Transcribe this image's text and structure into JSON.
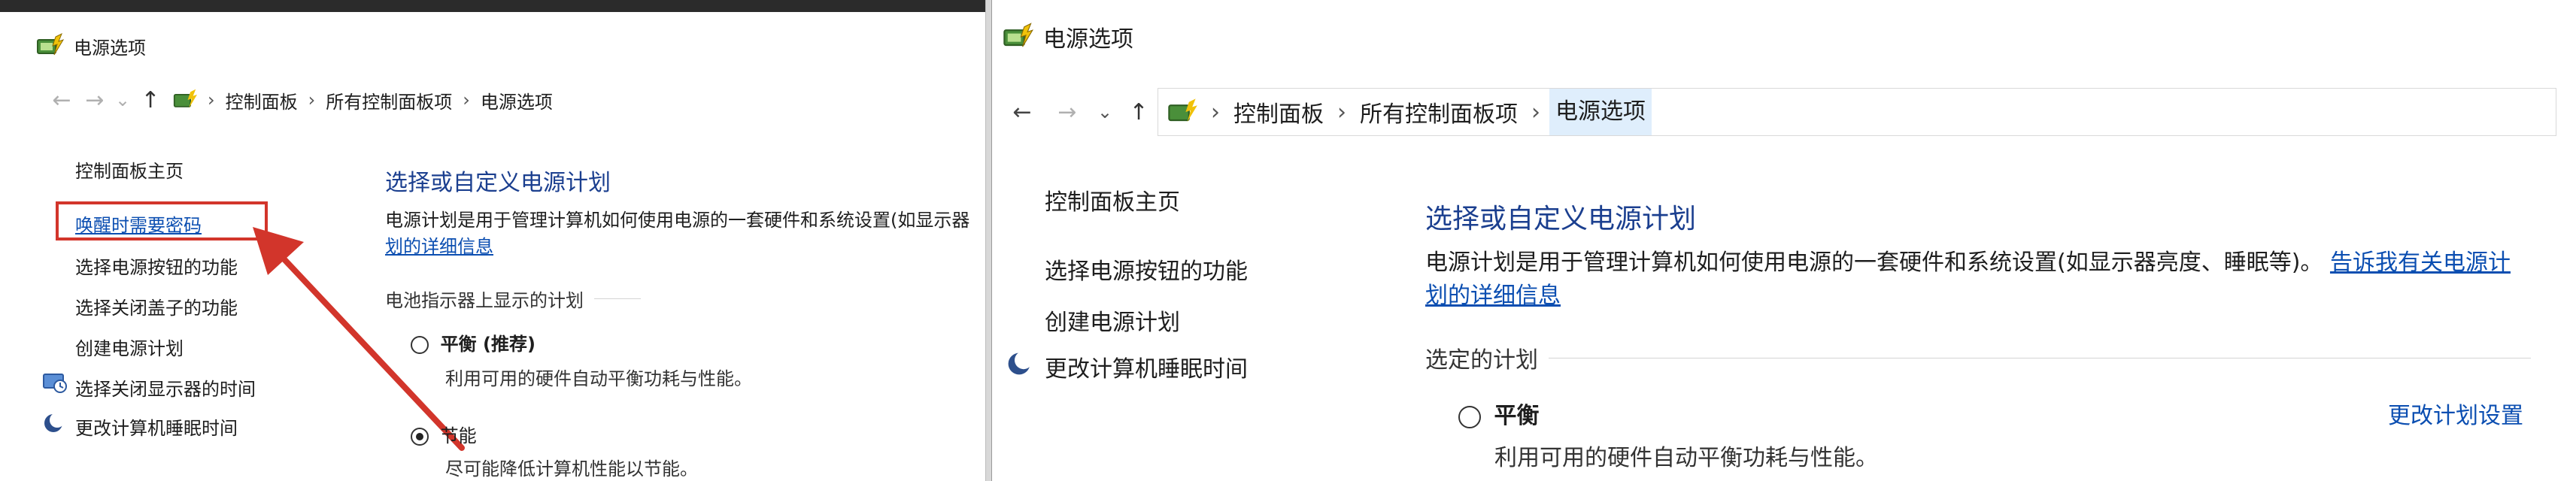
{
  "window_left": {
    "title": "电源选项",
    "breadcrumb": [
      "控制面板",
      "所有控制面板项",
      "电源选项"
    ],
    "left_items": [
      "控制面板主页",
      "唤醒时需要密码",
      "选择电源按钮的功能",
      "选择关闭盖子的功能",
      "创建电源计划",
      "选择关闭显示器的时间",
      "更改计算机睡眠时间"
    ],
    "heading": "选择或自定义电源计划",
    "desc_text": "电源计划是用于管理计算机如何使用电源的一套硬件和系统设置(如显示器",
    "desc_link": "划的详细信息",
    "section_label": "电池指示器上显示的计划",
    "plans": [
      {
        "name": "平衡 (推荐)",
        "desc": "利用可用的硬件自动平衡功耗与性能。",
        "selected": false
      },
      {
        "name": "节能",
        "desc": "尽可能降低计算机性能以节能。",
        "selected": true
      }
    ]
  },
  "window_right": {
    "title": "电源选项",
    "breadcrumb": [
      "控制面板",
      "所有控制面板项",
      "电源选项"
    ],
    "left_items": [
      "控制面板主页",
      "选择电源按钮的功能",
      "创建电源计划",
      "更改计算机睡眠时间"
    ],
    "heading": "选择或自定义电源计划",
    "desc_text": "电源计划是用于管理计算机如何使用电源的一套硬件和系统设置(如显示器亮度、睡眠等)。",
    "desc_link_1": "告诉我有关电源计",
    "desc_link_2": "划的详细信息",
    "section_label": "选定的计划",
    "plan": {
      "name": "平衡",
      "desc": "利用可用的硬件自动平衡功耗与性能。",
      "selected": false
    },
    "change_link": "更改计划设置"
  },
  "nav": {
    "back": "←",
    "forward": "→",
    "recent": "⌄",
    "up": "↑",
    "sep": "›"
  },
  "colors": {
    "link": "#0b4eb1",
    "heading": "#1b3f8f",
    "highlight": "#d2352b",
    "current_crumb": "#dfeefc"
  }
}
